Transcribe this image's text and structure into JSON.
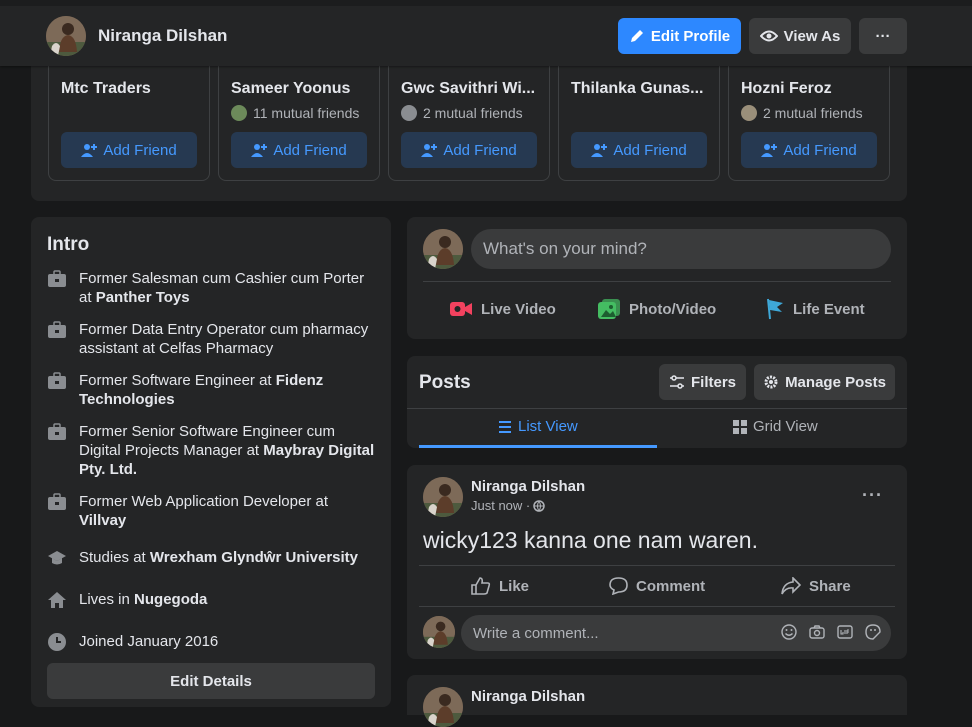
{
  "header": {
    "name": "Niranga Dilshan",
    "edit_profile": "Edit Profile",
    "view_as": "View As",
    "more": "···"
  },
  "friends": [
    {
      "name": "Mtc Traders",
      "mutual": "",
      "button": "Add Friend"
    },
    {
      "name": "Sameer Yoonus",
      "mutual": "11 mutual friends",
      "button": "Add Friend"
    },
    {
      "name": "Gwc Savithri Wi...",
      "mutual": "2 mutual friends",
      "button": "Add Friend"
    },
    {
      "name": "Thilanka Gunas...",
      "mutual": "",
      "button": "Add Friend"
    },
    {
      "name": "Hozni Feroz",
      "mutual": "2 mutual friends",
      "button": "Add Friend"
    }
  ],
  "intro": {
    "title": "Intro",
    "items": [
      {
        "icon": "briefcase-icon",
        "text": "Former Salesman cum Cashier cum Porter at ",
        "bold": "Panther Toys"
      },
      {
        "icon": "briefcase-icon",
        "text": "Former Data Entry Operator cum pharmacy assistant at Celfas Pharmacy",
        "bold": ""
      },
      {
        "icon": "briefcase-icon",
        "text": "Former Software Engineer at ",
        "bold": "Fidenz Technologies"
      },
      {
        "icon": "briefcase-icon",
        "text": "Former Senior Software Engineer cum Digital Projects Manager at ",
        "bold": "Maybray Digital Pty. Ltd."
      },
      {
        "icon": "briefcase-icon",
        "text": "Former Web Application Developer at ",
        "bold": "Villvay"
      },
      {
        "icon": "graduation-cap-icon",
        "text": "Studies at ",
        "bold": "Wrexham Glyndŵr University"
      },
      {
        "icon": "home-icon",
        "text": "Lives in ",
        "bold": "Nugegoda"
      },
      {
        "icon": "clock-icon",
        "text": "Joined January 2016",
        "bold": ""
      }
    ],
    "edit_details": "Edit Details"
  },
  "composer": {
    "placeholder": "What's on your mind?",
    "live_video": "Live Video",
    "photo_video": "Photo/Video",
    "life_event": "Life Event"
  },
  "posts_header": {
    "title": "Posts",
    "filters": "Filters",
    "manage_posts": "Manage Posts",
    "list_view": "List View",
    "grid_view": "Grid View"
  },
  "post": {
    "author": "Niranga Dilshan",
    "time": "Just now ·",
    "body": "wicky123 kanna one nam waren.",
    "like": "Like",
    "comment": "Comment",
    "share": "Share",
    "comment_placeholder": "Write a comment..."
  },
  "post2": {
    "author": "Niranga Dilshan"
  },
  "colors": {
    "background": "#18191a",
    "card": "#242526",
    "primary": "#2d88ff",
    "link": "#4599ff"
  }
}
